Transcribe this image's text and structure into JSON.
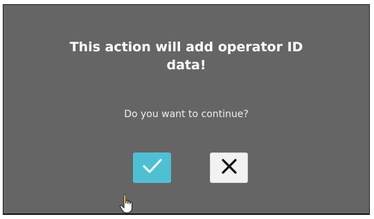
{
  "dialog": {
    "title": "This action will add operator ID data!",
    "message": "Do you want to continue?",
    "confirm_icon": "check-icon",
    "cancel_icon": "x-icon"
  },
  "colors": {
    "overlay_bg": "#656565",
    "confirm_bg": "#4fc0d4",
    "cancel_bg": "#f2f2f2",
    "title_text": "#ffffff"
  },
  "cursor": {
    "icon": "hand-pointer-icon"
  }
}
